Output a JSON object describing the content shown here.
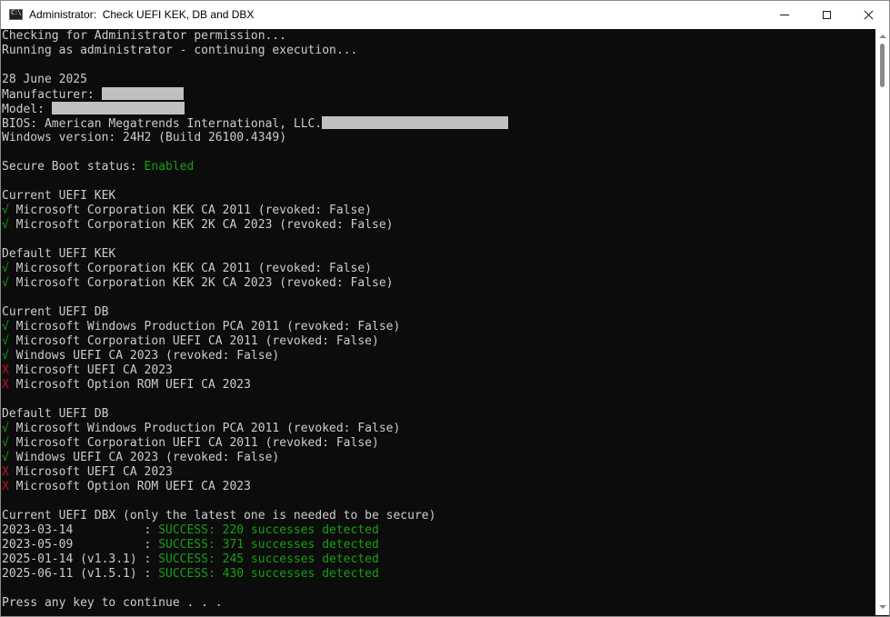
{
  "window": {
    "title": "Administrator:  Check UEFI KEK, DB and DBX",
    "icon": "cmd-console-icon"
  },
  "console": {
    "line1": "Checking for Administrator permission...",
    "line2": "Running as administrator - continuing execution...",
    "date": "28 June 2025",
    "manufacturer_label": "Manufacturer: ",
    "model_label": "Model: ",
    "bios_label": "BIOS: American Megatrends International, LLC.",
    "windows_version": "Windows version: 24H2 (Build 26100.4349)",
    "secure_boot_label": "Secure Boot status: ",
    "secure_boot_value": "Enabled",
    "check_mark": "√",
    "cross_mark": "X",
    "current_kek_header": "Current UEFI KEK",
    "current_kek": [
      " Microsoft Corporation KEK CA 2011 (revoked: False)",
      " Microsoft Corporation KEK 2K CA 2023 (revoked: False)"
    ],
    "default_kek_header": "Default UEFI KEK",
    "default_kek": [
      " Microsoft Corporation KEK CA 2011 (revoked: False)",
      " Microsoft Corporation KEK 2K CA 2023 (revoked: False)"
    ],
    "current_db_header": "Current UEFI DB",
    "current_db": [
      " Microsoft Windows Production PCA 2011 (revoked: False)",
      " Microsoft Corporation UEFI CA 2011 (revoked: False)",
      " Windows UEFI CA 2023 (revoked: False)",
      " Microsoft UEFI CA 2023",
      " Microsoft Option ROM UEFI CA 2023"
    ],
    "default_db_header": "Default UEFI DB",
    "default_db": [
      " Microsoft Windows Production PCA 2011 (revoked: False)",
      " Microsoft Corporation UEFI CA 2011 (revoked: False)",
      " Windows UEFI CA 2023 (revoked: False)",
      " Microsoft UEFI CA 2023",
      " Microsoft Option ROM UEFI CA 2023"
    ],
    "dbx_header": "Current UEFI DBX (only the latest one is needed to be secure)",
    "dbx": [
      {
        "date": "2023-03-14          : ",
        "result": "SUCCESS: 220 successes detected"
      },
      {
        "date": "2023-05-09          : ",
        "result": "SUCCESS: 371 successes detected"
      },
      {
        "date": "2025-01-14 (v1.3.1) : ",
        "result": "SUCCESS: 245 successes detected"
      },
      {
        "date": "2025-06-11 (v1.5.1) : ",
        "result": "SUCCESS: 430 successes detected"
      }
    ],
    "prompt": "Press any key to continue . . ."
  },
  "colors": {
    "background": "#0c0c0c",
    "text": "#cccccc",
    "success": "#13a10e",
    "failure": "#c50f1f",
    "redaction": "#c0c0c0"
  }
}
